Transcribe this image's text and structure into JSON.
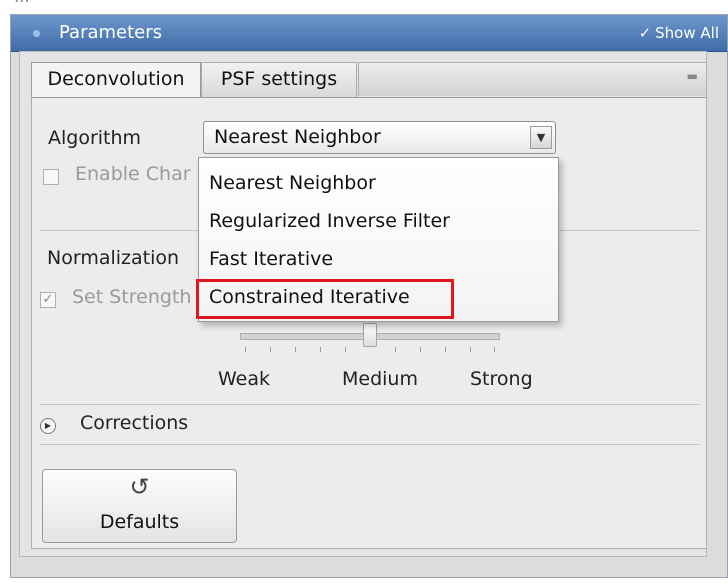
{
  "header": {
    "title": "Parameters",
    "show_all": "Show All",
    "show_all_check": "✓"
  },
  "tabs": [
    {
      "label": "Deconvolution",
      "active": true
    },
    {
      "label": "PSF settings",
      "active": false
    }
  ],
  "algorithm": {
    "label": "Algorithm",
    "selected": "Nearest Neighbor",
    "options": [
      "Nearest Neighbor",
      "Regularized Inverse Filter",
      "Fast Iterative",
      "Constrained Iterative"
    ],
    "highlighted_option": "Constrained Iterative"
  },
  "enable_channel": {
    "label": "Enable Char",
    "checked": false
  },
  "normalization": {
    "label": "Normalization"
  },
  "set_strength": {
    "label": "Set Strength",
    "checked": true
  },
  "strength_slider": {
    "labels": [
      "Weak",
      "Medium",
      "Strong"
    ],
    "value_label": "Medium"
  },
  "corrections": {
    "label": "Corrections"
  },
  "defaults_button": {
    "label": "Defaults"
  },
  "colors": {
    "titlebar": "#4a78b4",
    "highlight": "#e0161d"
  }
}
